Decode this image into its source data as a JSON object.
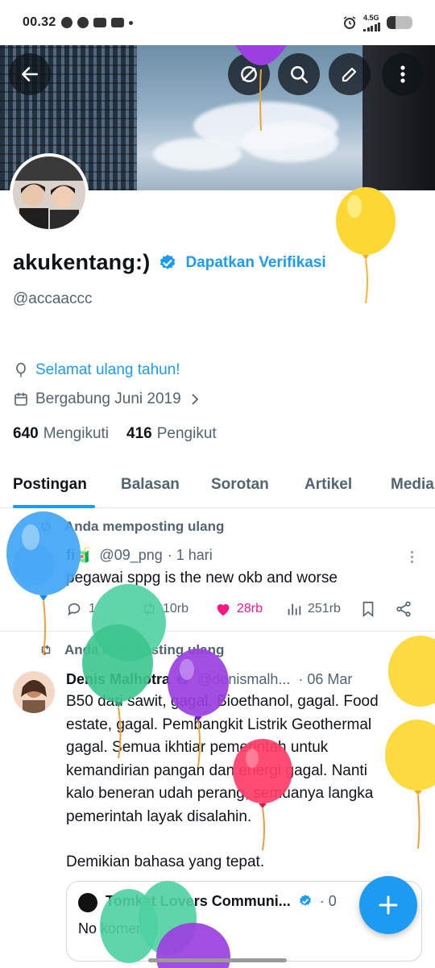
{
  "status_bar": {
    "time": "00.32",
    "network": "4.5G",
    "icons": [
      "whatsapp-icon",
      "chat-icon",
      "capcut-icon",
      "youtube-icon",
      "dot",
      "alarm-icon",
      "signal-icon",
      "battery-icon"
    ],
    "battery_level": 0.35
  },
  "header": {
    "buttons": [
      "back-icon",
      "sync-icon",
      "search-icon",
      "compose-icon",
      "more-icon"
    ]
  },
  "profile": {
    "display_name": "akukentang:)",
    "get_verified": "Dapatkan Verifikasi",
    "handle": "@accaaccc",
    "birthday_text": "Selamat ulang tahun!",
    "joined_text": "Bergabung Juni 2019",
    "following_count": "640",
    "following_label": "Mengikuti",
    "followers_count": "416",
    "followers_label": "Pengikut"
  },
  "tabs": [
    {
      "label": "Postingan",
      "active": true
    },
    {
      "label": "Balasan",
      "active": false
    },
    {
      "label": "Sorotan",
      "active": false
    },
    {
      "label": "Artikel",
      "active": false
    },
    {
      "label": "Media",
      "active": false
    }
  ],
  "posts": [
    {
      "repost_label": "Anda memposting ulang",
      "author": "fi🧃",
      "username": "@09_png",
      "time": "· 1 hari",
      "text": "pegawai sppg is the new okb and worse",
      "replies": "1",
      "reposts": "10rb",
      "likes": "28rb",
      "views": "251rb"
    },
    {
      "repost_label": "Anda memposting ulang",
      "author": "Denis Malhotra",
      "username": "@denismalh...",
      "time": "· 06 Mar",
      "text_lines": [
        "B50 dari sawit, gagal. Bioethanol, gagal. Food",
        "estate, gagal. Pembangkit Listrik Geothermal",
        "gagal. Semua ikhtiar pemerintah untuk",
        "kemandirian pangan dan energi gagal. Nanti",
        "kalo beneran udah perang, semuanya langka",
        "pemerintah layak disalahin."
      ],
      "text_last": "Demikian bahasa yang tepat.",
      "quote": {
        "author": "Tomket Lovers Communi...",
        "time": "· 0",
        "text": "No komen"
      }
    }
  ],
  "colors": {
    "accent": "#1d9bf0",
    "like": "#f91880",
    "text": "#0f1419",
    "secondary": "#536471"
  }
}
